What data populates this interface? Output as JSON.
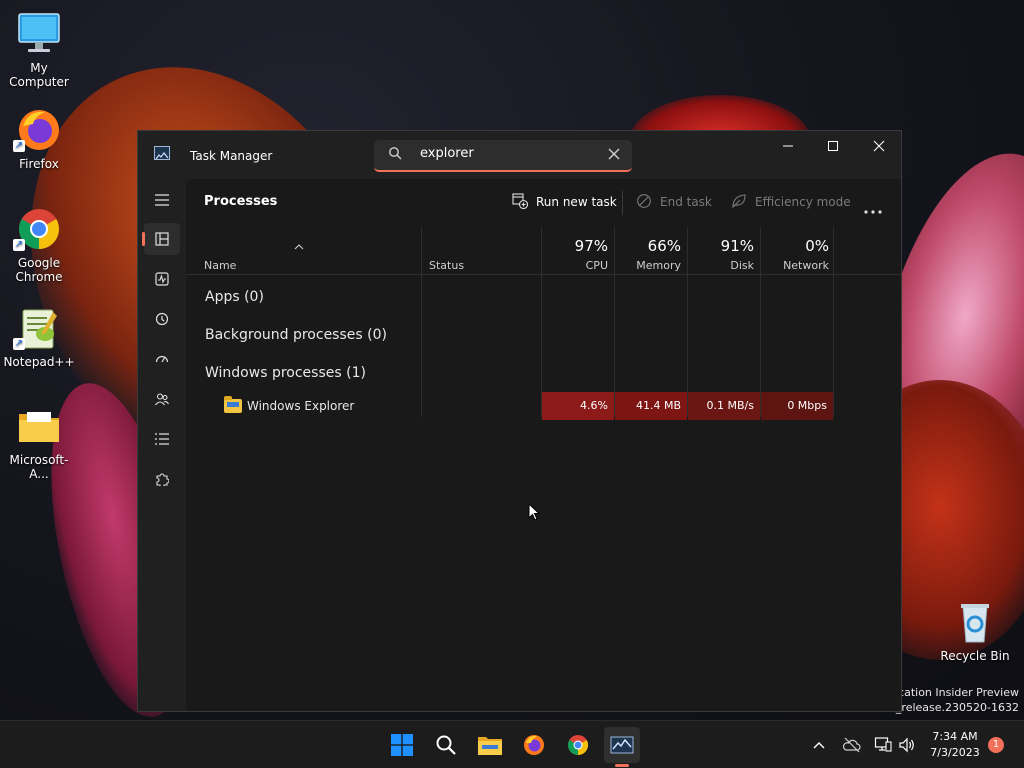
{
  "desktop": {
    "icons": [
      {
        "label": "My Computer"
      },
      {
        "label": "Firefox"
      },
      {
        "label": "Google Chrome"
      },
      {
        "label": "Notepad++"
      },
      {
        "label": "Microsoft-A..."
      },
      {
        "label": "Recycle Bin"
      }
    ],
    "watermark": {
      "line1": "ication Insider Preview",
      "line2": "n_release.230520-1632"
    }
  },
  "window": {
    "title": "Task Manager",
    "search": {
      "value": "explorer",
      "placeholder": ""
    },
    "page_title": "Processes",
    "commands": {
      "run_new_task": "Run new task",
      "end_task": "End task",
      "efficiency_mode": "Efficiency mode"
    },
    "columns": {
      "name": "Name",
      "status": "Status",
      "cpu": {
        "pct": "97%",
        "label": "CPU"
      },
      "memory": {
        "pct": "66%",
        "label": "Memory"
      },
      "disk": {
        "pct": "91%",
        "label": "Disk"
      },
      "network": {
        "pct": "0%",
        "label": "Network"
      }
    },
    "groups": [
      {
        "label": "Apps (0)"
      },
      {
        "label": "Background processes (0)"
      },
      {
        "label": "Windows processes (1)"
      }
    ],
    "processes": [
      {
        "name": "Windows Explorer",
        "cpu": "4.6%",
        "memory": "41.4 MB",
        "disk": "0.1 MB/s",
        "network": "0 Mbps"
      }
    ]
  },
  "taskbar": {
    "clock": {
      "time": "7:34 AM",
      "date": "7/3/2023"
    },
    "notification_count": "1"
  },
  "colors": {
    "accent": "#f0705a",
    "heat_cpu": "#8c1a18",
    "heat_memory": "#7d1512",
    "heat_disk": "#6a1612",
    "heat_network": "#5e1410"
  }
}
